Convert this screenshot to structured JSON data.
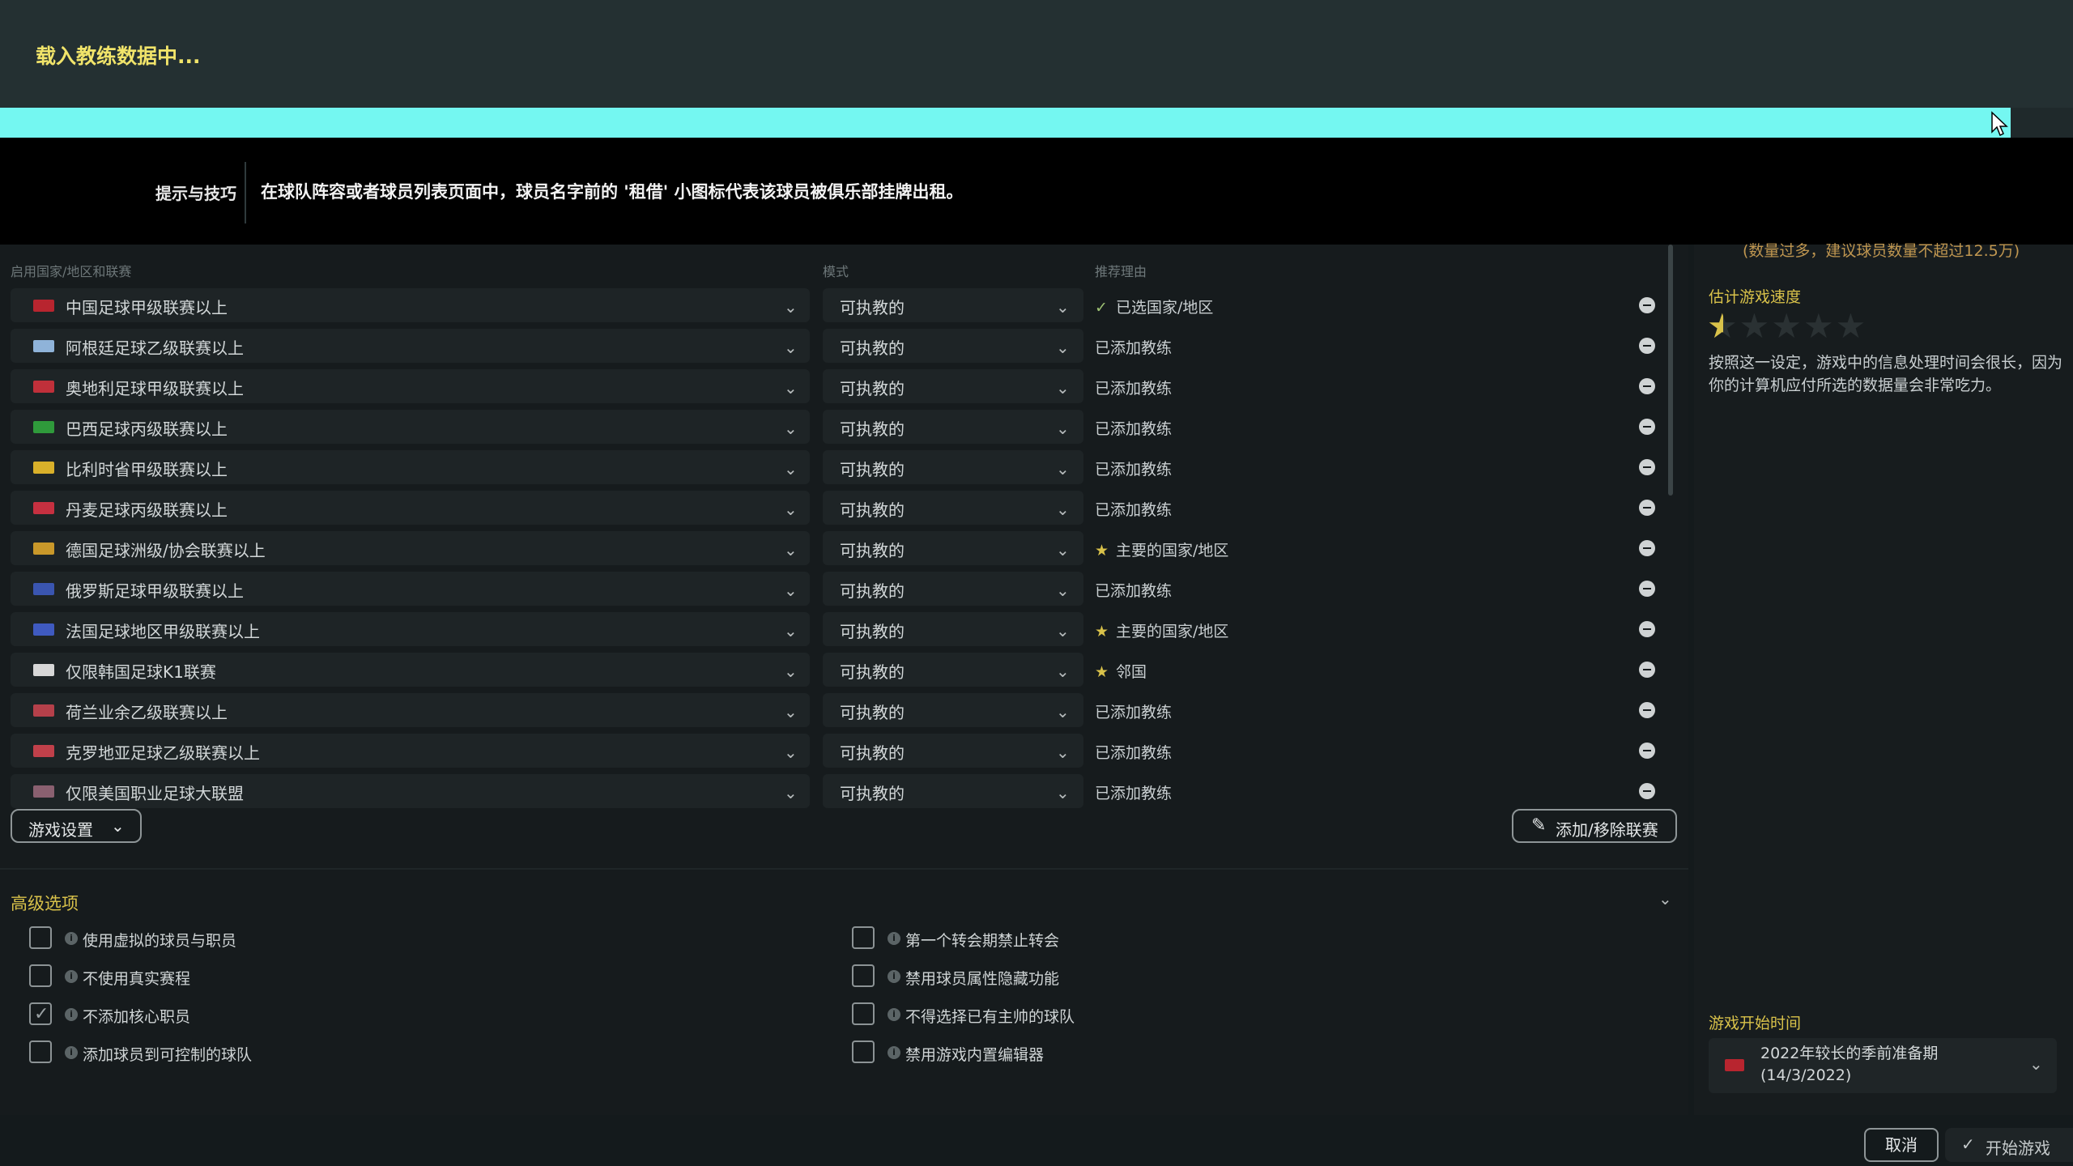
{
  "loading": {
    "title": "载入教练数据中...",
    "progress": 0.97
  },
  "tips": {
    "label": "提示与技巧",
    "text": "在球队阵容或者球员列表页面中，球员名字前的 '租借' 小图标代表该球员被俱乐部挂牌出租。"
  },
  "table": {
    "headers": {
      "league": "启用国家/地区和联赛",
      "mode": "模式",
      "reason": "推荐理由"
    },
    "rows": [
      {
        "flag": "#b8252f",
        "league": "中国足球甲级联赛以上",
        "mode": "可执教的",
        "reason": "已选国家/地区",
        "marker": "check"
      },
      {
        "flag": "#8fb3d9",
        "league": "阿根廷足球乙级联赛以上",
        "mode": "可执教的",
        "reason": "已添加教练",
        "marker": ""
      },
      {
        "flag": "#c0303a",
        "league": "奥地利足球甲级联赛以上",
        "mode": "可执教的",
        "reason": "已添加教练",
        "marker": ""
      },
      {
        "flag": "#2f9a3b",
        "league": "巴西足球丙级联赛以上",
        "mode": "可执教的",
        "reason": "已添加教练",
        "marker": ""
      },
      {
        "flag": "#d9b02a",
        "league": "比利时省甲级联赛以上",
        "mode": "可执教的",
        "reason": "已添加教练",
        "marker": ""
      },
      {
        "flag": "#c63040",
        "league": "丹麦足球丙级联赛以上",
        "mode": "可执教的",
        "reason": "已添加教练",
        "marker": ""
      },
      {
        "flag": "#c9982a",
        "league": "德国足球洲级/协会联赛以上",
        "mode": "可执教的",
        "reason": "主要的国家/地区",
        "marker": "star"
      },
      {
        "flag": "#3a55b0",
        "league": "俄罗斯足球甲级联赛以上",
        "mode": "可执教的",
        "reason": "已添加教练",
        "marker": ""
      },
      {
        "flag": "#3f5ac0",
        "league": "法国足球地区甲级联赛以上",
        "mode": "可执教的",
        "reason": "主要的国家/地区",
        "marker": "star"
      },
      {
        "flag": "#d7d7d7",
        "league": "仅限韩国足球K1联赛",
        "mode": "可执教的",
        "reason": "邻国",
        "marker": "star"
      },
      {
        "flag": "#b5404a",
        "league": "荷兰业余乙级联赛以上",
        "mode": "可执教的",
        "reason": "已添加教练",
        "marker": ""
      },
      {
        "flag": "#c0404a",
        "league": "克罗地亚足球乙级联赛以上",
        "mode": "可执教的",
        "reason": "已添加教练",
        "marker": ""
      },
      {
        "flag": "#8a6070",
        "league": "仅限美国职业足球大联盟",
        "mode": "可执教的",
        "reason": "已添加教练",
        "marker": ""
      }
    ]
  },
  "buttons": {
    "game_settings": "游戏设置",
    "add_remove_league": "添加/移除联赛",
    "cancel": "取消",
    "start": "开始游戏"
  },
  "advanced": {
    "title": "高级选项",
    "left": [
      {
        "label": "使用虚拟的球员与职员",
        "checked": false
      },
      {
        "label": "不使用真实赛程",
        "checked": false
      },
      {
        "label": "不添加核心职员",
        "checked": true
      },
      {
        "label": "添加球员到可控制的球队",
        "checked": false
      }
    ],
    "right": [
      {
        "label": "第一个转会期禁止转会",
        "checked": false
      },
      {
        "label": "禁用球员属性隐藏功能",
        "checked": false
      },
      {
        "label": "不得选择已有主帅的球队",
        "checked": false
      },
      {
        "label": "禁用游戏内置编辑器",
        "checked": false
      }
    ]
  },
  "side": {
    "warning": "(数量过多，建议球员数量不超过12.5万)",
    "speed_title": "估计游戏速度",
    "speed_rating": 0.5,
    "speed_max": 5,
    "speed_desc": "按照这一设定，游戏中的信息处理时间会很长，因为你的计算机应付所选的数据量会非常吃力。",
    "start_title": "游戏开始时间",
    "start_value_line1": "2022年较长的季前准备期",
    "start_value_line2": "(14/3/2022)"
  },
  "icons": {
    "cursor": "mouse-cursor-icon",
    "remove": "minus-circle-icon",
    "pencil": "pencil-icon",
    "check": "check-icon",
    "star": "star-icon"
  }
}
